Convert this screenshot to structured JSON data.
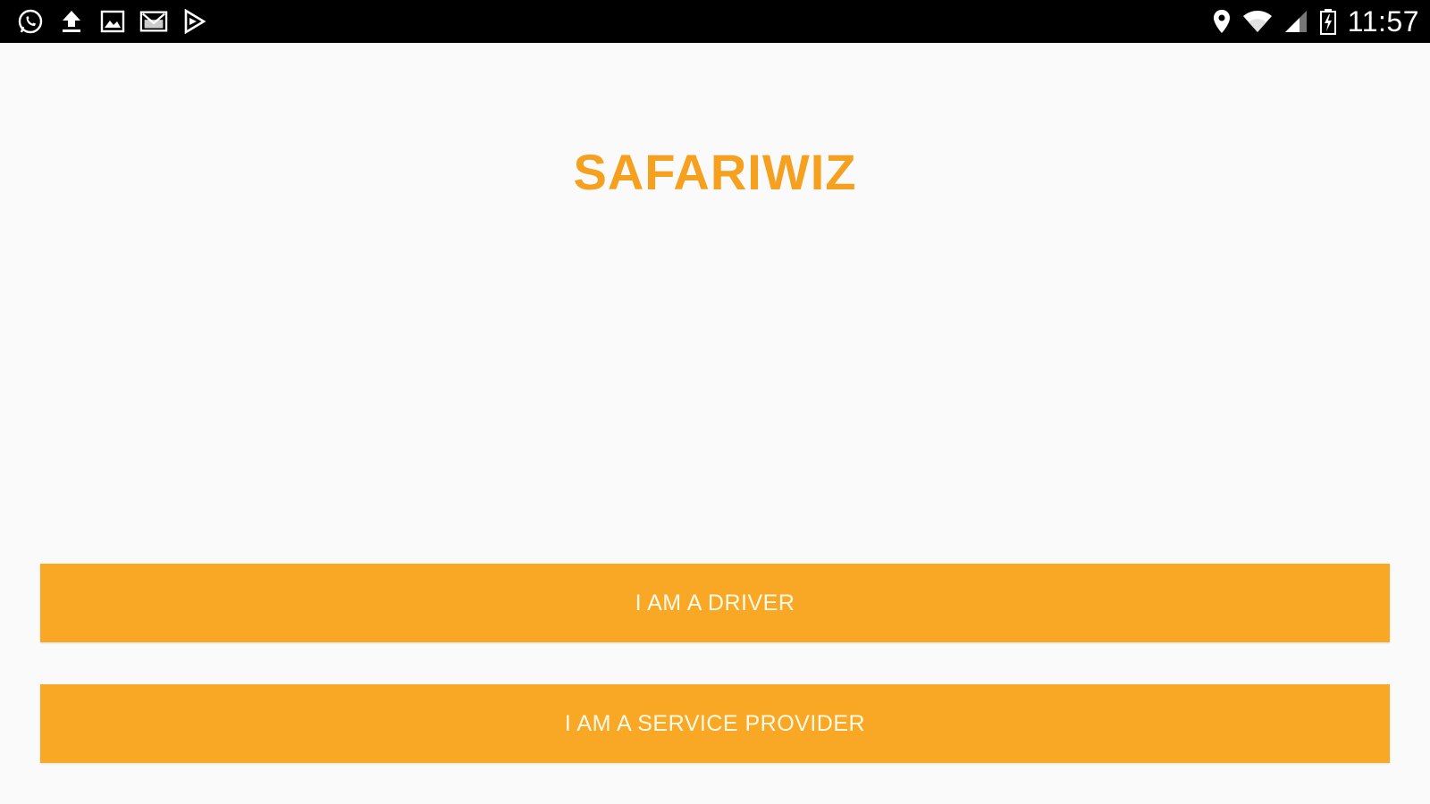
{
  "status_bar": {
    "left_icons": [
      "whatsapp-icon",
      "upload-icon",
      "image-icon",
      "gmail-icon",
      "play-store-icon"
    ],
    "right_icons": [
      "location-icon",
      "wifi-icon",
      "signal-icon",
      "battery-icon"
    ],
    "time": "11:57"
  },
  "app": {
    "title": "SAFARIWIZ",
    "driver_button_label": "I AM A DRIVER",
    "provider_button_label": "I AM A SERVICE PROVIDER"
  },
  "colors": {
    "accent": "#f9a825",
    "title": "#f5a11f",
    "background": "#fafafa",
    "status_bar": "#000000"
  }
}
